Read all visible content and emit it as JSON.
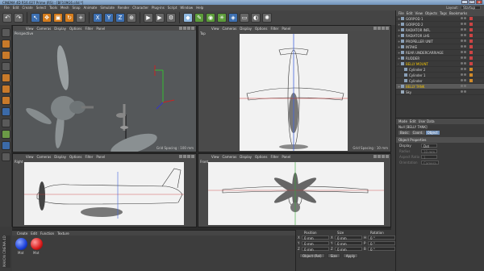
{
  "window": {
    "title": "CINEMA 4D R16.027 Prime (RS) - [BF109G6.c4d *]"
  },
  "menubar": {
    "items": [
      "File",
      "Edit",
      "Create",
      "Select",
      "Tools",
      "Mesh",
      "Snap",
      "Animate",
      "Simulate",
      "Render",
      "Character",
      "Plug-ins",
      "Script",
      "Window",
      "Help"
    ],
    "layout_label": "Layout:",
    "layout_value": "Startup"
  },
  "viewports": [
    {
      "name": "Perspective",
      "menu": [
        "View",
        "Cameras",
        "Display",
        "Options",
        "Filter",
        "Panel"
      ],
      "grid": "Grid Spacing : 100 mm"
    },
    {
      "name": "Top",
      "menu": [
        "View",
        "Cameras",
        "Display",
        "Options",
        "Filter",
        "Panel"
      ],
      "grid": "Grid Spacing : 10 mm"
    },
    {
      "name": "Right",
      "menu": [
        "View",
        "Cameras",
        "Display",
        "Options",
        "Filter",
        "Panel"
      ],
      "grid": ""
    },
    {
      "name": "Front",
      "menu": [
        "View",
        "Cameras",
        "Display",
        "Options",
        "Filter",
        "Panel"
      ],
      "grid": ""
    }
  ],
  "object_manager": {
    "menu": [
      "File",
      "Edit",
      "View",
      "Objects",
      "Tags",
      "Bookmarks"
    ],
    "objects": [
      "GORPOD 1",
      "GORPOD 2",
      "RADIATOR INFL",
      "RADIATOR LHS",
      "PROPELLER UNIT",
      "INTAKE",
      "REAR UNDERCARRIAGE",
      "RUDDER",
      "BELLY MOUNT",
      "Cylinder 2",
      "Cylinder 1",
      "Cylinder",
      "BELLY TANK",
      "Sky"
    ]
  },
  "attributes": {
    "menu": [
      "Mode",
      "Edit",
      "User Data"
    ],
    "title": "Null [BELLY TANK]",
    "tabs": [
      "Basic",
      "Coord.",
      "Object"
    ],
    "section": "Object Properties",
    "rows": [
      {
        "label": "Display",
        "value": "Dot"
      },
      {
        "label": "Radius",
        "value": "10 mm"
      },
      {
        "label": "Aspect Ratio",
        "value": "1"
      },
      {
        "label": "Orientation",
        "value": "Camera"
      }
    ]
  },
  "materials": {
    "menu": [
      "Create",
      "Edit",
      "Function",
      "Texture"
    ],
    "items": [
      {
        "label": "Mat",
        "color": "#1a3fd9"
      },
      {
        "label": "Mat",
        "color": "#d91a1a"
      }
    ]
  },
  "coordinates": {
    "headers": [
      "Position",
      "Size",
      "Rotation"
    ],
    "rows": [
      [
        "X",
        "0 mm",
        "X",
        "0 mm",
        "H",
        "0 °"
      ],
      [
        "Y",
        "0 mm",
        "Y",
        "0 mm",
        "P",
        "0 °"
      ],
      [
        "Z",
        "0 mm",
        "Z",
        "0 mm",
        "B",
        "0 °"
      ]
    ],
    "mode": "Object (Rel)",
    "size_mode": "Size",
    "apply": "Apply"
  },
  "logo": "MAXON CINEMA 4D"
}
